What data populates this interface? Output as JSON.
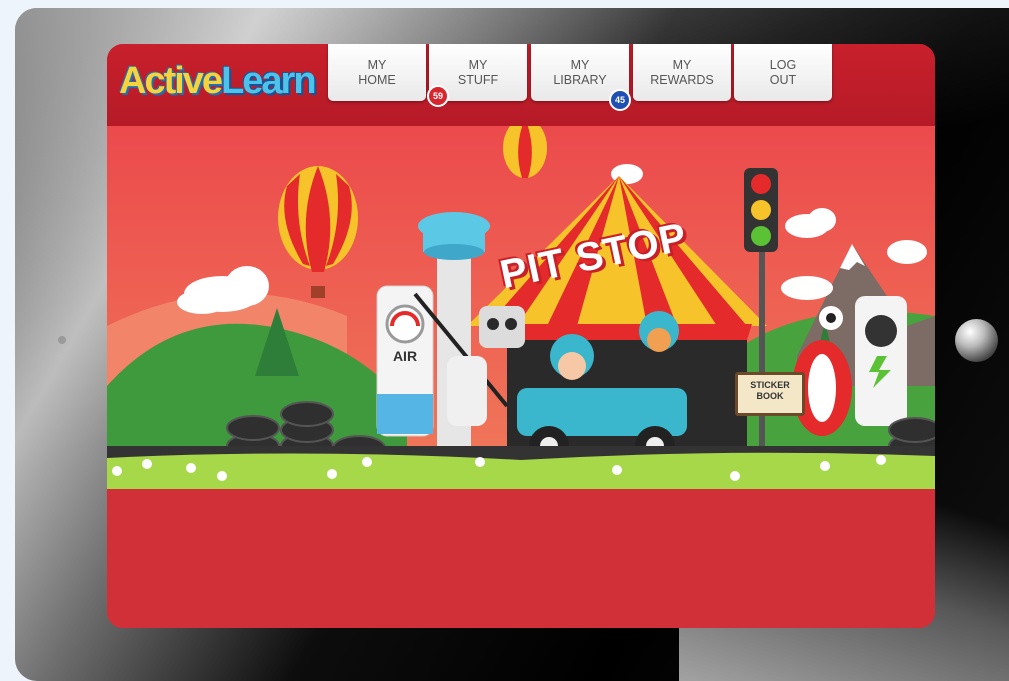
{
  "logo": {
    "part1": "Active",
    "part2": "Learn"
  },
  "nav": [
    {
      "line1": "MY",
      "line2": "HOME"
    },
    {
      "line1": "MY",
      "line2": "STUFF",
      "badge": "59",
      "badge_color": "#d8262f"
    },
    {
      "line1": "MY",
      "line2": "LIBRARY",
      "badge": "45",
      "badge_color": "#1f4fb3"
    },
    {
      "line1": "MY",
      "line2": "REWARDS"
    },
    {
      "line1": "LOG",
      "line2": "OUT"
    }
  ],
  "scene": {
    "sign": "PIT STOP",
    "air_label": "AIR",
    "sticker_book": {
      "line1": "STICKER",
      "line2": "BOOK"
    }
  },
  "colors": {
    "header": "#c8202c",
    "background": "#d23038",
    "sky": "#ec544f",
    "grass": "#a6d84a"
  }
}
